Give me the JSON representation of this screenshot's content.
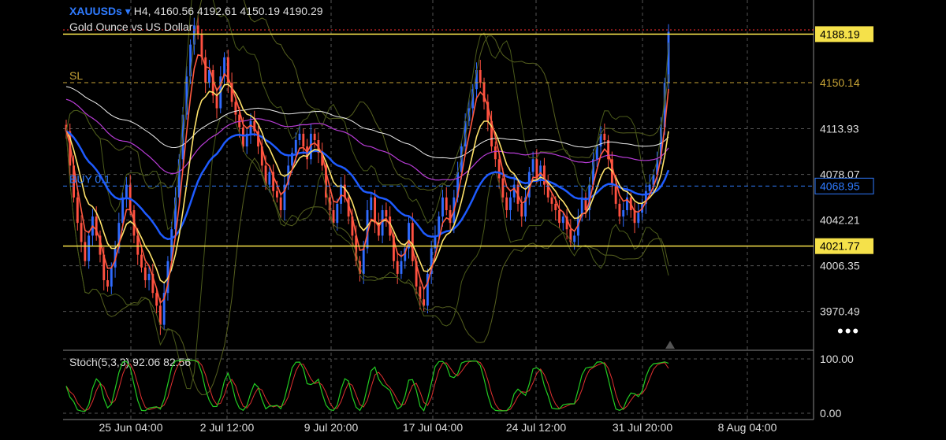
{
  "header": {
    "symbol": "XAUUSDs",
    "symbol_arrow": "▾",
    "timeframe": "H4",
    "open": "4160.56",
    "high": "4192.61",
    "low": "4150.19",
    "close": "4190.29",
    "description": "Gold Ounce vs US Dollar"
  },
  "more_label": "•••",
  "colors": {
    "background": "#000000",
    "grid": "#555555",
    "bull": "#2f6bff",
    "bear": "#ff5040",
    "yellow_line": "#f5e14a",
    "sl_line": "#c8a436",
    "buy_line": "#2f7bff",
    "red_ma": "#ff5a40",
    "yellow_ma": "#ffe36a",
    "blue_ma": "#1e5bff",
    "purple_ma": "#b83cd6",
    "white_ma": "#eeeeee",
    "bands": "#56601f",
    "stoch_k": "#22cc22",
    "stoch_d": "#e03030"
  },
  "chart_data": [
    {
      "type": "candlestick",
      "title": "XAUUSDs H4",
      "ylim": [
        3940,
        4215
      ],
      "y_ticks": [
        "4113.93",
        "4078.07",
        "4042.21",
        "4006.35",
        "3970.49"
      ],
      "x_tick_labels": [
        "25 Jun 04:00",
        "2 Jul 12:00",
        "9 Jul 20:00",
        "17 Jul 04:00",
        "24 Jul 12:00",
        "31 Jul 20:00",
        "8 Aug 04:00"
      ],
      "price_lines": [
        {
          "label": "",
          "value": 4188.19,
          "tag": "4188.19",
          "style": "solid-yellow"
        },
        {
          "label": "SL",
          "value": 4150.14,
          "tag": "4150.14",
          "style": "dashed-gold"
        },
        {
          "label": "BUY 0.1",
          "value": 4068.95,
          "tag": "4068.95",
          "style": "dashed-blue"
        },
        {
          "label": "",
          "value": 4021.77,
          "tag": "4021.77",
          "style": "solid-yellow"
        }
      ],
      "close_series": [
        4112,
        4085,
        4060,
        4040,
        4025,
        4010,
        4030,
        4045,
        4030,
        4015,
        3995,
        3990,
        4005,
        4020,
        4040,
        4060,
        4070,
        4050,
        4030,
        4015,
        4005,
        3995,
        4000,
        3985,
        3975,
        3960,
        3985,
        4010,
        4035,
        4060,
        4090,
        4125,
        4155,
        4180,
        4195,
        4188,
        4170,
        4150,
        4160,
        4140,
        4130,
        4155,
        4170,
        4150,
        4135,
        4125,
        4115,
        4100,
        4110,
        4120,
        4112,
        4100,
        4085,
        4070,
        4080,
        4065,
        4060,
        4050,
        4070,
        4085,
        4095,
        4105,
        4110,
        4100,
        4090,
        4110,
        4105,
        4095,
        4085,
        4060,
        4050,
        4040,
        4055,
        4070,
        4060,
        4045,
        4030,
        4010,
        4000,
        4020,
        4050,
        4060,
        4040,
        4030,
        4050,
        4045,
        4030,
        4010,
        4000,
        4010,
        4020,
        4040,
        4010,
        3990,
        3980,
        3975,
        4000,
        4020,
        4030,
        4045,
        4060,
        4050,
        4040,
        4060,
        4080,
        4100,
        4120,
        4130,
        4145,
        4160,
        4150,
        4135,
        4120,
        4100,
        4090,
        4075,
        4060,
        4050,
        4060,
        4070,
        4055,
        4045,
        4060,
        4080,
        4090,
        4075,
        4085,
        4070,
        4060,
        4055,
        4050,
        4040,
        4045,
        4035,
        4025,
        4030,
        4045,
        4060,
        4050,
        4070,
        4090,
        4100,
        4110,
        4105,
        4090,
        4070,
        4055,
        4045,
        4050,
        4060,
        4050,
        4040,
        4048,
        4055,
        4065,
        4070,
        4078,
        4090,
        4115,
        4150,
        4190
      ]
    },
    {
      "type": "line",
      "title": "Stoch(5,3,3) 92.06 82.56",
      "ylim": [
        0,
        100
      ],
      "y_ticks": [
        "100.00",
        "0.00"
      ],
      "k_last": 92.06,
      "d_last": 82.56
    }
  ]
}
